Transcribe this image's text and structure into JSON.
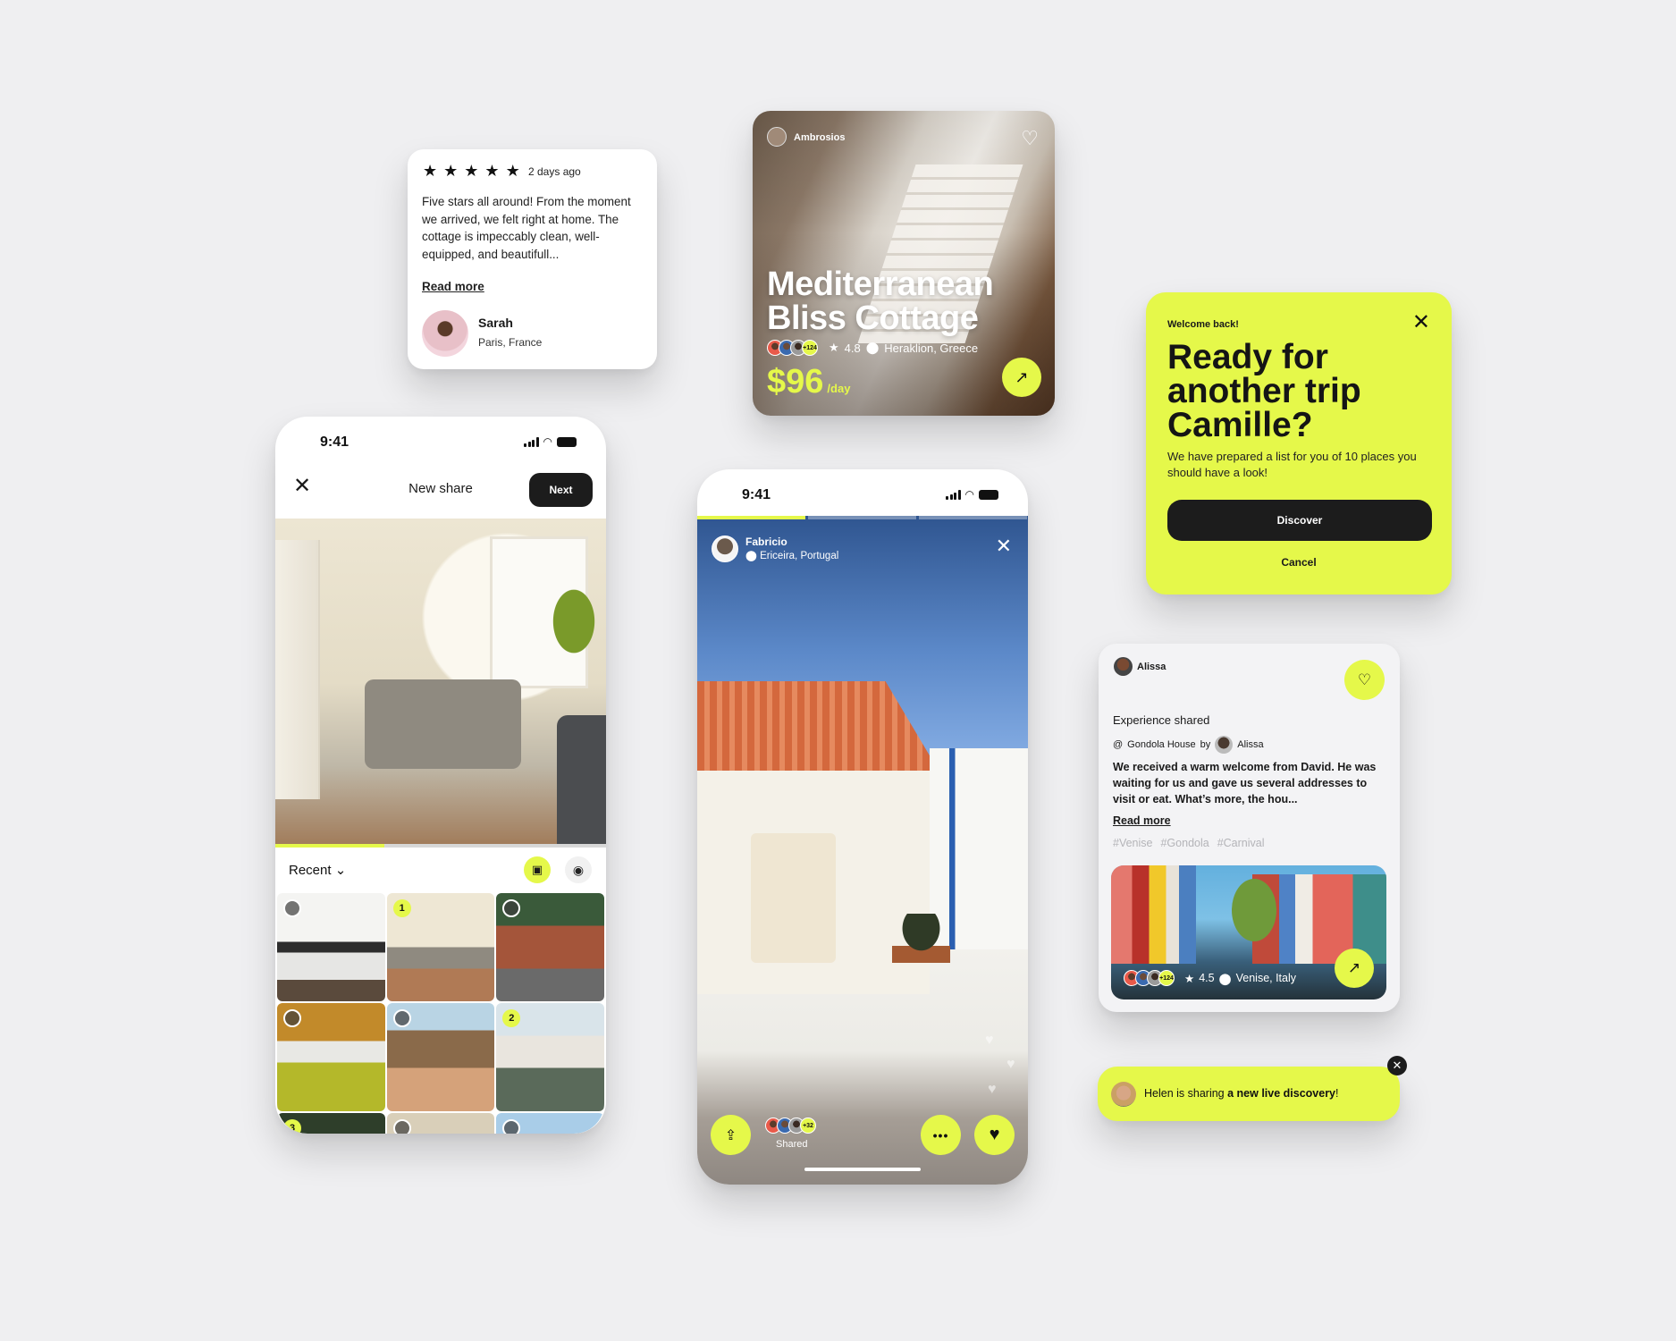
{
  "accent_color": "#e5f84a",
  "review": {
    "stars": 5,
    "time_ago": "2 days ago",
    "body": "Five stars all around! From the moment we arrived, we felt right at home. The cottage is impeccably clean, well-equipped, and beautifull...",
    "read_more": "Read more",
    "author": "Sarah",
    "location": "Paris, France"
  },
  "listing": {
    "host": "Ambrosios",
    "title": "Mediterranean Bliss Cottage",
    "guests_extra": "+124",
    "rating": "4.8",
    "location": "Heraklion, Greece",
    "price": "$96",
    "price_unit": "/day",
    "icons": {
      "favorite": "heart-outline-icon",
      "open": "arrow-up-right-icon",
      "rating": "star-icon",
      "location": "map-pin-icon"
    }
  },
  "welcome": {
    "eyebrow": "Welcome back!",
    "headline": "Ready for another trip Camille?",
    "subtitle": "We have prepared a list for you of 10 places you should have a look!",
    "primary": "Discover",
    "secondary": "Cancel"
  },
  "share_screen": {
    "status_time": "9:41",
    "title": "New share",
    "next": "Next",
    "album": "Recent",
    "tiles": [
      {
        "selected": false,
        "order": ""
      },
      {
        "selected": true,
        "order": "1"
      },
      {
        "selected": false,
        "order": ""
      },
      {
        "selected": false,
        "order": ""
      },
      {
        "selected": false,
        "order": ""
      },
      {
        "selected": true,
        "order": "2"
      },
      {
        "selected": true,
        "order": "3"
      },
      {
        "selected": false,
        "order": ""
      },
      {
        "selected": false,
        "order": ""
      }
    ]
  },
  "story": {
    "status_time": "9:41",
    "user": "Fabricio",
    "location": "Ericeira, Portugal",
    "viewers_extra": "+32",
    "shared_label": "Shared",
    "segments_total": 3,
    "segment_active": 1
  },
  "experience": {
    "user": "Alissa",
    "label": "Experience shared",
    "place": "Gondola House",
    "by": "by",
    "author": "Alissa",
    "body": "We received a warm welcome from David. He was waiting for us and gave us several addresses to visit or eat. What’s more, the hou...",
    "read_more": "Read more",
    "tags": [
      "#Venise",
      "#Gondola",
      "#Carnival"
    ],
    "guests_extra": "+124",
    "rating": "4.5",
    "location": "Venise, Italy"
  },
  "toast": {
    "name_part": "Helen is sharing ",
    "bold_part": "a new live discovery",
    "tail": "!"
  }
}
